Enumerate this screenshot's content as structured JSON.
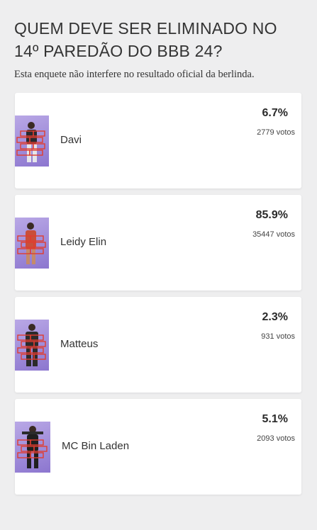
{
  "poll": {
    "title": "QUEM DEVE SER ELIMINADO NO 14º PAREDÃO DO BBB 24?",
    "subtitle": "Esta enquete não interfere no resultado oficial da berlinda."
  },
  "options": [
    {
      "name": "Davi",
      "percent": "6.7%",
      "votes": "2779 votos"
    },
    {
      "name": "Leidy Elin",
      "percent": "85.9%",
      "votes": "35447 votos"
    },
    {
      "name": "Matteus",
      "percent": "2.3%",
      "votes": "931 votos"
    },
    {
      "name": "MC Bin Laden",
      "percent": "5.1%",
      "votes": "2093 votos"
    }
  ],
  "colors": {
    "page_background": "#eeeeef",
    "card_background": "#ffffff",
    "photo_background": "#a894dc",
    "wall_bricks": "#e03c2f"
  },
  "icons": [
    "participant-photo"
  ]
}
